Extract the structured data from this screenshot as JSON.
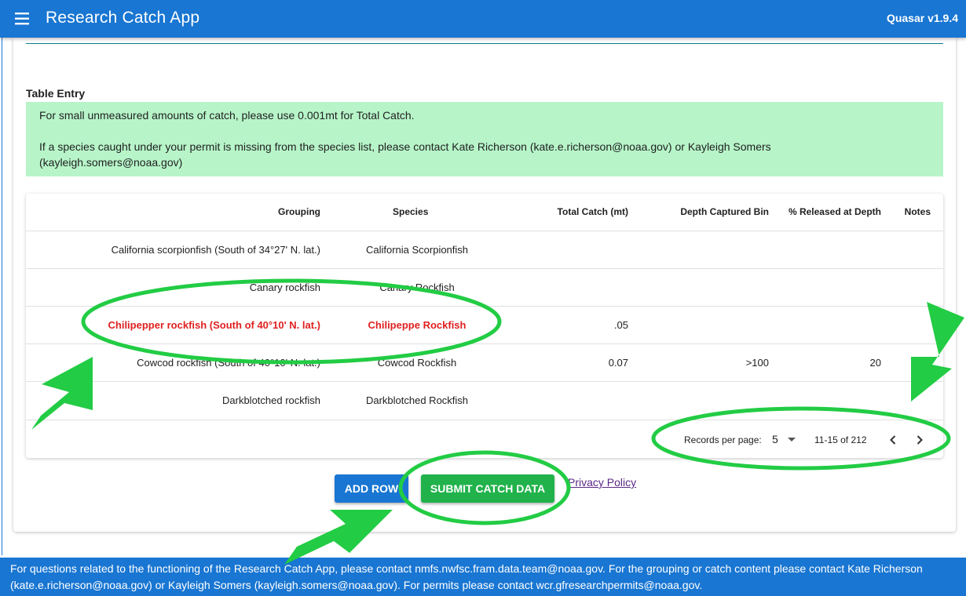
{
  "app": {
    "title": "Research Catch App",
    "version": "Quasar v1.9.4"
  },
  "section": {
    "title": "Table Entry"
  },
  "banner": {
    "line1": "For small unmeasured amounts of catch, please use 0.001mt for Total Catch.",
    "line2": "If a species caught under your permit is missing from the species list, please contact Kate Richerson (kate.e.richerson@noaa.gov) or Kayleigh Somers (kayleigh.somers@noaa.gov)"
  },
  "table": {
    "headers": {
      "grouping": "Grouping",
      "species": "Species",
      "total_catch": "Total Catch (mt)",
      "depth_bin": "Depth Captured Bin",
      "released": "% Released at Depth",
      "notes": "Notes"
    },
    "rows": [
      {
        "grouping": "California scorpionfish (South of 34°27' N. lat.)",
        "species": "California Scorpionfish",
        "total_catch": "",
        "depth_bin": "",
        "released": "",
        "notes": ""
      },
      {
        "grouping": "Canary rockfish",
        "species": "Canary Rockfish",
        "total_catch": "",
        "depth_bin": "",
        "released": "",
        "notes": ""
      },
      {
        "grouping": "Chilipepper rockfish (South of 40°10' N. lat.)",
        "species": "Chilipeppe Rockfish",
        "total_catch": ".05",
        "depth_bin": "",
        "released": "",
        "notes": ""
      },
      {
        "grouping": "Cowcod rockfish (South of 40°10' N. lat.)",
        "species": "Cowcod Rockfish",
        "total_catch": "0.07",
        "depth_bin": ">100",
        "released": "20",
        "notes": ""
      },
      {
        "grouping": "Darkblotched rockfish",
        "species": "Darkblotched Rockfish",
        "total_catch": "",
        "depth_bin": "",
        "released": "",
        "notes": ""
      }
    ],
    "pagination": {
      "records_label": "Records per page:",
      "records_value": "5",
      "range": "11-15 of 212"
    }
  },
  "actions": {
    "add_row": "ADD ROW",
    "submit": "SUBMIT CATCH DATA",
    "privacy": "Privacy Policy"
  },
  "footer": {
    "text": "For questions related to the functioning of the Research Catch App, please contact nmfs.nwfsc.fram.data.team@noaa.gov. For the grouping or catch content please contact Kate Richerson (kate.e.richerson@noaa.gov) or Kayleigh Somers (kayleigh.somers@noaa.gov). For permits please contact wcr.gfresearchpermits@noaa.gov."
  },
  "colors": {
    "primary": "#1976d2",
    "banner": "#b7f5c9",
    "submit": "#21b24b",
    "highlight": "#e02020",
    "annotation": "#22cc44"
  },
  "icons": {
    "menu": "menu-icon",
    "prev": "chevron-left-icon",
    "next": "chevron-right-icon",
    "dropdown": "caret-down-icon"
  }
}
